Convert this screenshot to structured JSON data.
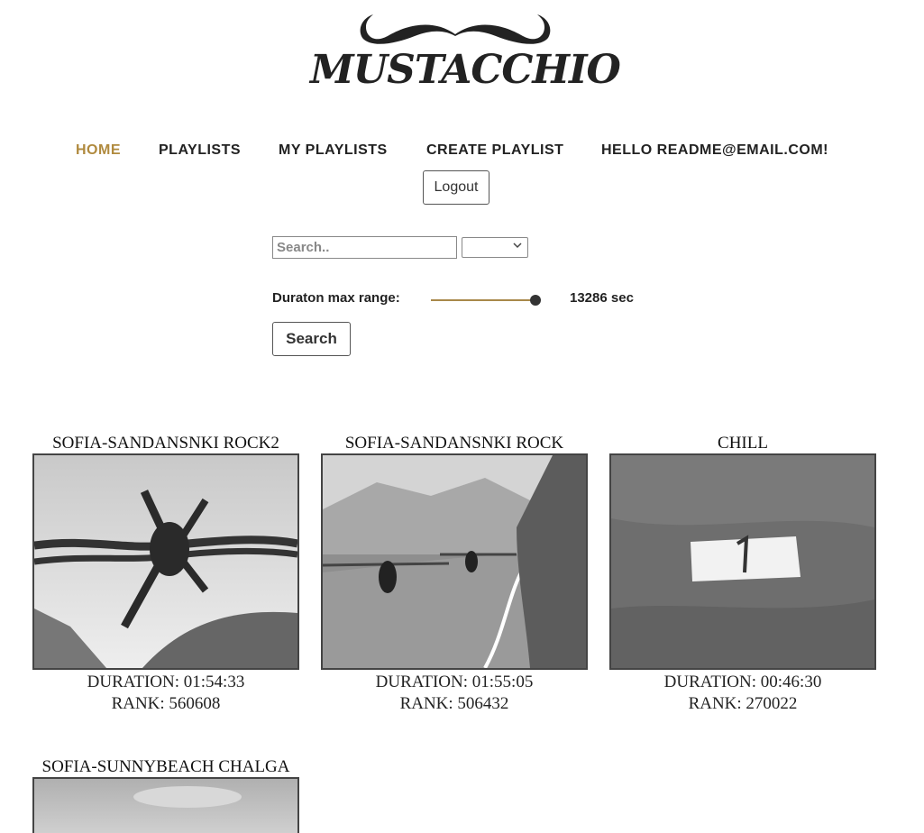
{
  "logo": {
    "text": "MUSTACCHIO"
  },
  "nav": {
    "items": [
      {
        "label": "HOME",
        "active": true
      },
      {
        "label": "PLAYLISTS",
        "active": false
      },
      {
        "label": "MY PLAYLISTS",
        "active": false
      },
      {
        "label": "CREATE PLAYLIST",
        "active": false
      },
      {
        "label": "HELLO README@EMAIL.COM!",
        "active": false
      }
    ],
    "logout_label": "Logout"
  },
  "search": {
    "placeholder": "Search..",
    "value": "",
    "select_value": "",
    "duration_label": "Duraton max range:",
    "duration_value": "13286 sec",
    "slider_fraction": 0.95,
    "button_label": "Search"
  },
  "playlists": [
    {
      "title": "SOFIA-SANDANSNKI ROCK2",
      "duration": "DURATION: 01:54:33",
      "rank": "RANK: 560608",
      "image": "barbed-wire-photo"
    },
    {
      "title": "SOFIA-SANDANSNKI ROCK",
      "duration": "DURATION: 01:55:05",
      "rank": "RANK: 506432",
      "image": "motorcycle-road-photo"
    },
    {
      "title": "CHILL",
      "duration": "DURATION: 00:46:30",
      "rank": "RANK: 270022",
      "image": "rock-number-one-photo"
    },
    {
      "title": "SOFIA-SUNNYBEACH CHALGA",
      "duration": "",
      "rank": "",
      "image": "sky-photo"
    }
  ],
  "colors": {
    "accent": "#b08a3e",
    "text": "#222222"
  }
}
